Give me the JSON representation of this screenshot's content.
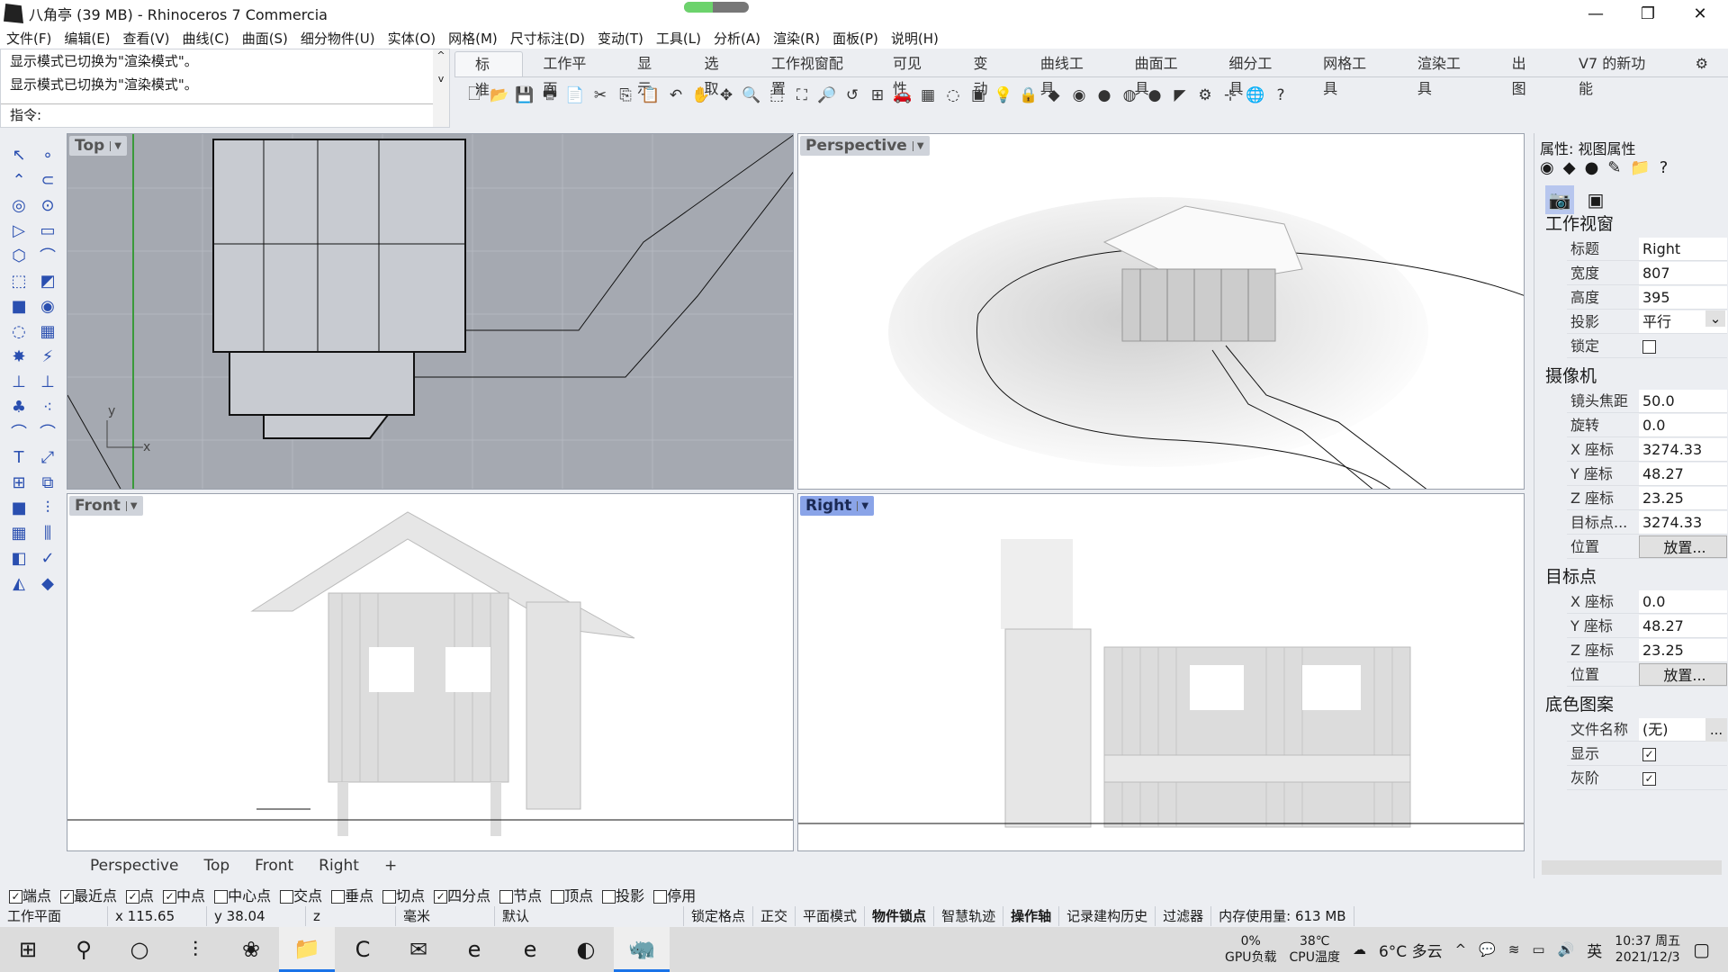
{
  "window": {
    "title": "八角亭 (39 MB) - Rhinoceros 7 Commercia",
    "progress_fraction": 0.45,
    "minimize": "—",
    "restore": "❐",
    "close": "✕"
  },
  "menu": [
    "文件(F)",
    "编辑(E)",
    "查看(V)",
    "曲线(C)",
    "曲面(S)",
    "细分物件(U)",
    "实体(O)",
    "网格(M)",
    "尺寸标注(D)",
    "变动(T)",
    "工具(L)",
    "分析(A)",
    "渲染(R)",
    "面板(P)",
    "说明(H)"
  ],
  "command": {
    "history": [
      "显示模式已切换为\"渲染模式\"。",
      "显示模式已切换为\"渲染模式\"。"
    ],
    "prompt": "指令:",
    "value": ""
  },
  "tabs": [
    "标准",
    "工作平面",
    "显示",
    "选取",
    "工作视窗配置",
    "可见性",
    "变动",
    "曲线工具",
    "曲面工具",
    "细分工具",
    "网格工具",
    "渲染工具",
    "出图",
    "V7 的新功能"
  ],
  "active_tab": "标准",
  "toolbar_icons": [
    "new-file",
    "open-folder",
    "save",
    "print",
    "import",
    "cut",
    "copy",
    "paste",
    "undo",
    "pan",
    "rotate-view",
    "zoom",
    "zoom-window",
    "zoom-extents",
    "zoom-selected",
    "undo-view",
    "four-viewports",
    "car",
    "grid",
    "circle-snap",
    "object-properties",
    "light-bulb",
    "lock",
    "material",
    "color-wheel",
    "sphere-gray",
    "sphere-grid",
    "sphere-blue",
    "cone-light",
    "gear-settings",
    "dimensions",
    "globe",
    "help"
  ],
  "toolbar_glyphs": [
    "🗋",
    "📂",
    "💾",
    "🖶",
    "📄",
    "✂",
    "⎘",
    "📋",
    "↶",
    "✋",
    "✥",
    "🔍",
    "⬚",
    "⛶",
    "🔎",
    "↺",
    "⊞",
    "🚗",
    "▦",
    "◌",
    "▣",
    "💡",
    "🔒",
    "◆",
    "◉",
    "●",
    "◍",
    "●",
    "◤",
    "⚙",
    "⊹",
    "🌐",
    "?"
  ],
  "left_tools": [
    "↖",
    "∘",
    "⌃",
    "⊂",
    "◎",
    "⊙",
    "▷",
    "▭",
    "⬡",
    "⌒",
    "⬚",
    "◩",
    "■",
    "◉",
    "◌",
    "▦",
    "✸",
    "⚡",
    "⊥",
    "⊥",
    "♣",
    "⁖",
    "⌒",
    "⌒",
    "T",
    "⤢",
    "⊞",
    "⧉",
    "■",
    "⫶",
    "▦",
    "⫼",
    "◧",
    "✓",
    "◭",
    "◆"
  ],
  "viewports": {
    "top": "Top",
    "perspective": "Perspective",
    "front": "Front",
    "right": "Right",
    "active": "Right"
  },
  "view_tabs": [
    "Perspective",
    "Top",
    "Front",
    "Right"
  ],
  "view_tabs_add": "+",
  "properties": {
    "title": "属性: 视图属性",
    "icons": [
      "◉",
      "◆",
      "●",
      "✎",
      "📁",
      "?"
    ],
    "sections": {
      "viewport": {
        "label": "工作视窗",
        "rows": [
          {
            "k": "标题",
            "v": "Right"
          },
          {
            "k": "宽度",
            "v": "807"
          },
          {
            "k": "高度",
            "v": "395"
          },
          {
            "k": "投影",
            "v": "平行"
          },
          {
            "k": "锁定",
            "v": "unchecked"
          }
        ]
      },
      "camera": {
        "label": "摄像机",
        "rows": [
          {
            "k": "镜头焦距",
            "v": "50.0"
          },
          {
            "k": "旋转",
            "v": "0.0"
          },
          {
            "k": "X 座标",
            "v": "3274.33"
          },
          {
            "k": "Y 座标",
            "v": "48.27"
          },
          {
            "k": "Z 座标",
            "v": "23.25"
          },
          {
            "k": "目标点...",
            "v": "3274.33"
          },
          {
            "k": "位置",
            "v": "放置..."
          }
        ]
      },
      "target": {
        "label": "目标点",
        "rows": [
          {
            "k": "X 座标",
            "v": "0.0"
          },
          {
            "k": "Y 座标",
            "v": "48.27"
          },
          {
            "k": "Z 座标",
            "v": "23.25"
          },
          {
            "k": "位置",
            "v": "放置..."
          }
        ]
      },
      "wallpaper": {
        "label": "底色图案",
        "rows": [
          {
            "k": "文件名称",
            "v": "(无)"
          },
          {
            "k": "显示",
            "v": "checked"
          },
          {
            "k": "灰阶",
            "v": "checked"
          }
        ],
        "browse": "..."
      }
    }
  },
  "osnaps": [
    {
      "label": "端点",
      "checked": true
    },
    {
      "label": "最近点",
      "checked": true
    },
    {
      "label": "点",
      "checked": true
    },
    {
      "label": "中点",
      "checked": true
    },
    {
      "label": "中心点",
      "checked": false
    },
    {
      "label": "交点",
      "checked": false
    },
    {
      "label": "垂点",
      "checked": false
    },
    {
      "label": "切点",
      "checked": false
    },
    {
      "label": "四分点",
      "checked": true
    },
    {
      "label": "节点",
      "checked": false
    },
    {
      "label": "顶点",
      "checked": false
    },
    {
      "label": "投影",
      "checked": false
    },
    {
      "label": "停用",
      "checked": false
    }
  ],
  "status": {
    "cplane": "工作平面",
    "x": "x 115.65",
    "y": "y 38.04",
    "z": "z",
    "units": "毫米",
    "layer": "默认",
    "toggles": [
      {
        "label": "锁定格点",
        "bold": false
      },
      {
        "label": "正交",
        "bold": false
      },
      {
        "label": "平面模式",
        "bold": false
      },
      {
        "label": "物件锁点",
        "bold": true
      },
      {
        "label": "智慧轨迹",
        "bold": false
      },
      {
        "label": "操作轴",
        "bold": true
      },
      {
        "label": "记录建构历史",
        "bold": false
      },
      {
        "label": "过滤器",
        "bold": false
      }
    ],
    "memory": "内存使用量: 613 MB"
  },
  "taskbar": {
    "items": [
      "⊞",
      "⚲",
      "○",
      "⫶",
      "❀",
      "📁",
      "C",
      "✉",
      "e",
      "e",
      "◐",
      "🦏"
    ],
    "names": [
      "start",
      "search",
      "cortana",
      "task-view",
      "app-pinwheel",
      "file-explorer",
      "app-c",
      "mail",
      "edge",
      "ie",
      "app-office",
      "rhino"
    ],
    "active": [
      "file-explorer",
      "rhino"
    ],
    "gpu": {
      "value": "0%",
      "label": "GPU负载"
    },
    "cpu": {
      "value": "38℃",
      "label": "CPU温度"
    },
    "weather": "6°C  多云",
    "ime": "英",
    "time": "10:37 周五",
    "date": "2021/12/3"
  }
}
